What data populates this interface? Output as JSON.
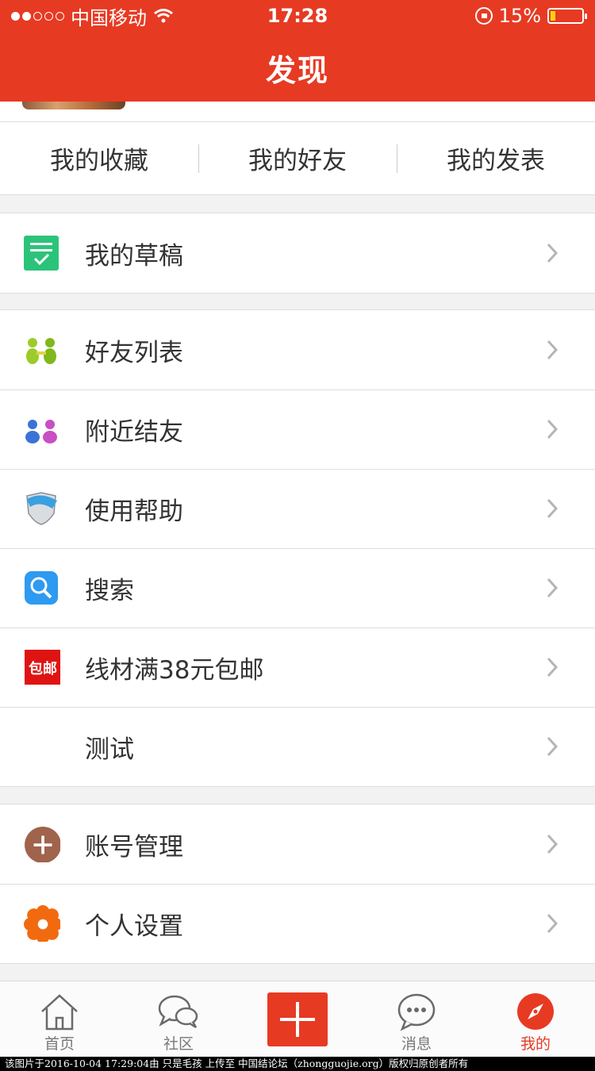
{
  "status_bar": {
    "carrier": "中国移动",
    "time": "17:28",
    "battery_text": "15%",
    "battery_level": 0.15
  },
  "nav": {
    "title": "发现"
  },
  "segments": [
    "我的收藏",
    "我的好友",
    "我的发表"
  ],
  "group1": [
    {
      "label": "我的草稿",
      "icon": "draft-icon"
    }
  ],
  "group2": [
    {
      "label": "好友列表",
      "icon": "friends-list-icon"
    },
    {
      "label": "附近结友",
      "icon": "nearby-friends-icon"
    },
    {
      "label": "使用帮助",
      "icon": "help-shield-icon"
    },
    {
      "label": "搜索",
      "icon": "search-icon"
    },
    {
      "label": "线材满38元包邮",
      "icon": "free-shipping-icon",
      "icon_text": "包邮"
    },
    {
      "label": "测试",
      "icon": ""
    }
  ],
  "group3": [
    {
      "label": "账号管理",
      "icon": "account-plus-icon"
    },
    {
      "label": "个人设置",
      "icon": "settings-flower-icon"
    }
  ],
  "tabbar": [
    {
      "label": "首页",
      "icon": "home-icon",
      "active": false
    },
    {
      "label": "社区",
      "icon": "chat-bubbles-icon",
      "active": false
    },
    {
      "label": "",
      "icon": "plus-icon",
      "active": false
    },
    {
      "label": "消息",
      "icon": "message-dots-icon",
      "active": false
    },
    {
      "label": "我的",
      "icon": "compass-icon",
      "active": true
    }
  ],
  "colors": {
    "brand_red": "#e73a23",
    "battery_yellow": "#ffd30a"
  },
  "watermark": "该图片于2016-10-04  17:29:04由  只是毛孩  上传至  中国结论坛（zhongguojie.org）版权归原创者所有"
}
